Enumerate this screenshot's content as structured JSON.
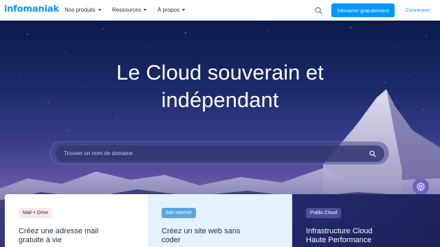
{
  "header": {
    "logo": "infomaniak",
    "nav": [
      {
        "label": "Nos produits"
      },
      {
        "label": "Ressources"
      },
      {
        "label": "À propos"
      }
    ],
    "cta_label": "Démarrer gratuitement",
    "login_label": "Connexion",
    "icons": {
      "search": "search-icon"
    }
  },
  "hero": {
    "title_line1": "Le Cloud souverain et",
    "title_line2": "indépendant",
    "search_placeholder": "Trouver un nom de domaine",
    "fab_icon": "gear-icon"
  },
  "cards": [
    {
      "badge": "Mail + Drive",
      "text_line1": "Créez une adresse mail",
      "text_line2": "gratuite à vie"
    },
    {
      "badge": "Site Internet",
      "text_line1": "Créez un site web sans",
      "text_line2": "coder"
    },
    {
      "badge": "Public Cloud",
      "text_line1": "Infrastructure Cloud",
      "text_line2": "Haute Performance"
    }
  ],
  "colors": {
    "brand": "#0098ff",
    "header_bg": "#ffffff",
    "card_mail_bg": "#ffffff",
    "card_site_bg": "#e4f3ff",
    "card_cloud_bg": "#232a6e"
  }
}
